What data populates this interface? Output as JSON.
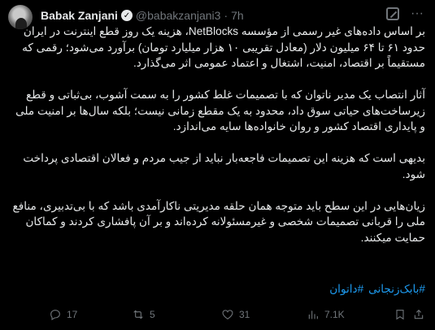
{
  "author": {
    "name": "Babak Zanjani",
    "verified_mark": "✓",
    "handle": "@babakzanjani3",
    "separator": "·",
    "time": "7h"
  },
  "top_icons": [
    "grok-icon",
    "more-icon"
  ],
  "more_label": "···",
  "paragraphs": [
    "بر اساس داده‌های غیر رسمی از مؤسسه NetBlocks، هزینه یک روز قطع اینترنت در ایران حدود ۶۱ تا ۶۴ میلیون دلار (معادل تقریبی ۱۰ هزار میلیارد تومان) برآورد می‌شود؛ رقمی که مستقیماً بر اقتصاد، امنیت، اشتغال و اعتماد عمومی اثر می‌گذارد.",
    "آثار انتصاب یک مدیر ناتوان که با تصمیمات غلط کشور را به سمت آشوب، بی‌ثباتی و قطع زیرساخت‌های حیاتی سوق داد، محدود به یک مقطع زمانی نیست؛ بلکه سال‌ها بر امنیت ملی و پایداری اقتصاد کشور و روان خانواده‌ها سایه می‌اندازد.",
    "بدیهی است که هزینه این تصمیمات فاجعه‌بار نباید از جیب مردم و فعالان اقتصادی پرداخت شود.",
    "زیان‌هایی در این سطح باید متوجه همان حلقه مدیریتی ناکارآمدی باشد که با بی‌تدبیری، منافع ملی را قربانی تصمیمات شخصی و غیرمسئولانه کرده‌اند و بر آن پافشاری کردند و کماکان حمایت میکنند."
  ],
  "hashtags": [
    "#بابک‌زنجانی",
    "#داتوان"
  ],
  "actions": {
    "replies": "17",
    "retweets": "5",
    "likes": "31",
    "views": "7.1K"
  }
}
